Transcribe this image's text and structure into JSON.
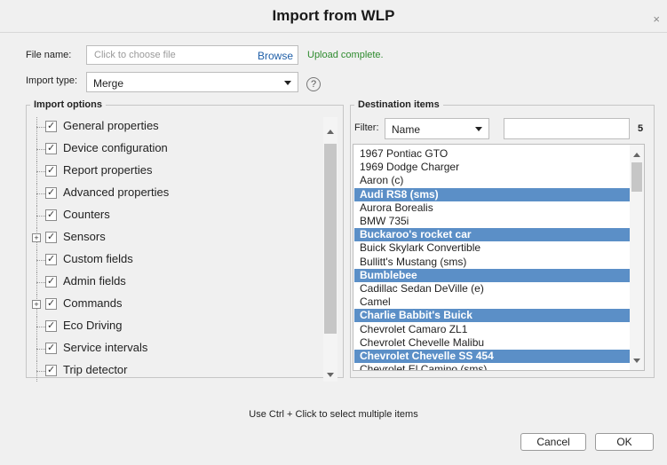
{
  "dialog": {
    "title": "Import from WLP",
    "close_glyph": "×"
  },
  "file": {
    "label": "File name:",
    "placeholder": "Click to choose file",
    "browse_label": "Browse",
    "status": "Upload complete."
  },
  "import_type": {
    "label": "Import type:",
    "value": "Merge"
  },
  "help_glyph": "?",
  "import_options": {
    "title": "Import options",
    "items": [
      {
        "label": "General properties",
        "checked": true,
        "expandable": false
      },
      {
        "label": "Device configuration",
        "checked": true,
        "expandable": false
      },
      {
        "label": "Report properties",
        "checked": true,
        "expandable": false
      },
      {
        "label": "Advanced properties",
        "checked": true,
        "expandable": false
      },
      {
        "label": "Counters",
        "checked": true,
        "expandable": false
      },
      {
        "label": "Sensors",
        "checked": true,
        "expandable": true
      },
      {
        "label": "Custom fields",
        "checked": true,
        "expandable": false
      },
      {
        "label": "Admin fields",
        "checked": true,
        "expandable": false
      },
      {
        "label": "Commands",
        "checked": true,
        "expandable": true
      },
      {
        "label": "Eco Driving",
        "checked": true,
        "expandable": false
      },
      {
        "label": "Service intervals",
        "checked": true,
        "expandable": false
      },
      {
        "label": "Trip detector",
        "checked": true,
        "expandable": false
      }
    ]
  },
  "destination": {
    "title": "Destination items",
    "filter_label": "Filter:",
    "filter_field": "Name",
    "filter_value": "",
    "selected_count": "5",
    "items": [
      {
        "label": "1967 Pontiac GTO",
        "selected": false
      },
      {
        "label": "1969 Dodge Charger",
        "selected": false
      },
      {
        "label": "Aaron (c)",
        "selected": false
      },
      {
        "label": "Audi RS8 (sms)",
        "selected": true
      },
      {
        "label": "Aurora Borealis",
        "selected": false
      },
      {
        "label": "BMW 735i",
        "selected": false
      },
      {
        "label": "Buckaroo's rocket car",
        "selected": true
      },
      {
        "label": "Buick Skylark Convertible",
        "selected": false
      },
      {
        "label": "Bullitt's Mustang (sms)",
        "selected": false
      },
      {
        "label": "Bumblebee",
        "selected": true
      },
      {
        "label": "Cadillac Sedan DeVille (e)",
        "selected": false
      },
      {
        "label": "Camel",
        "selected": false
      },
      {
        "label": "Charlie Babbit's Buick",
        "selected": true
      },
      {
        "label": "Chevrolet Camaro ZL1",
        "selected": false
      },
      {
        "label": "Chevrolet Chevelle Malibu",
        "selected": false
      },
      {
        "label": "Chevrolet Chevelle SS 454",
        "selected": true
      },
      {
        "label": "Chevrolet El Camino (sms)",
        "selected": false
      }
    ]
  },
  "hint": "Use Ctrl + Click to select multiple items",
  "buttons": {
    "cancel": "Cancel",
    "ok": "OK"
  },
  "colors": {
    "selection": "#5b8fc7",
    "status_ok": "#2e8b2e",
    "link": "#1f5fa8"
  }
}
